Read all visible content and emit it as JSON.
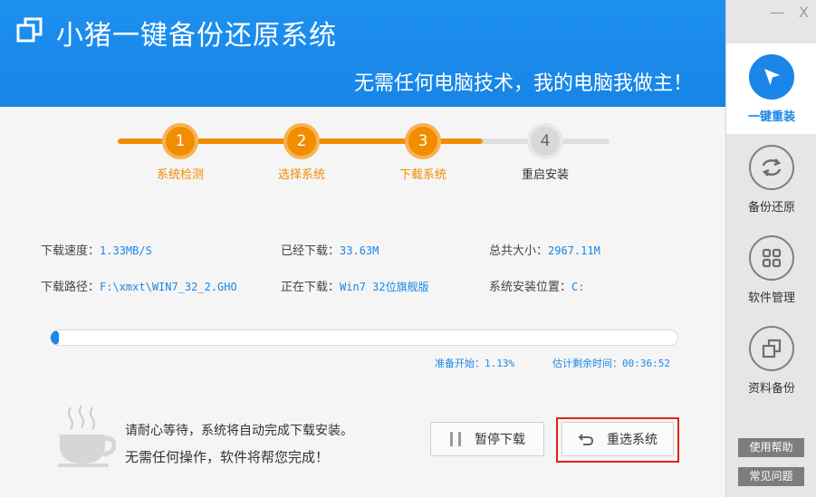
{
  "header": {
    "title": "小猪一键备份还原系统",
    "slogan": "无需任何电脑技术，我的电脑我做主！"
  },
  "window": {
    "minimize": "—",
    "close": "X"
  },
  "sidebar": {
    "items": [
      {
        "label": "一键重装",
        "icon": "cursor-arrow-icon",
        "active": true
      },
      {
        "label": "备份还原",
        "icon": "refresh-arrows-icon",
        "active": false
      },
      {
        "label": "软件管理",
        "icon": "grid-apps-icon",
        "active": false
      },
      {
        "label": "资料备份",
        "icon": "copy-squares-icon",
        "active": false
      }
    ],
    "help_button": "使用帮助",
    "faq_button": "常见问题"
  },
  "steps": [
    {
      "number": "1",
      "label": "系统检测",
      "state": "done"
    },
    {
      "number": "2",
      "label": "选择系统",
      "state": "done"
    },
    {
      "number": "3",
      "label": "下载系统",
      "state": "current"
    },
    {
      "number": "4",
      "label": "重启安装",
      "state": "pending"
    }
  ],
  "download_info": {
    "speed_label": "下载速度：",
    "speed_value": "1.33MB/S",
    "downloaded_label": "已经下载：",
    "downloaded_value": "33.63M",
    "total_label": "总共大小：",
    "total_value": "2967.11M",
    "path_label": "下载路径：",
    "path_value": "F:\\xmxt\\WIN7_32_2.GHO",
    "current_label": "正在下载：",
    "current_value": "Win7 32位旗舰版",
    "install_label": "系统安装位置：",
    "install_value": "C:"
  },
  "progress": {
    "percent": 1.13,
    "status_text": "准备开始：1.13%",
    "remaining_text": "估计剩余时间：00:36:52"
  },
  "messages": {
    "line1": "请耐心等待，系统将自动完成下载安装。",
    "line2": "无需任何操作，软件将帮您完成！"
  },
  "buttons": {
    "pause": "暂停下载",
    "reselect": "重选系统"
  },
  "colors": {
    "primary": "#1a86e8",
    "step_active": "#f28c00",
    "highlight": "#e5211d"
  }
}
